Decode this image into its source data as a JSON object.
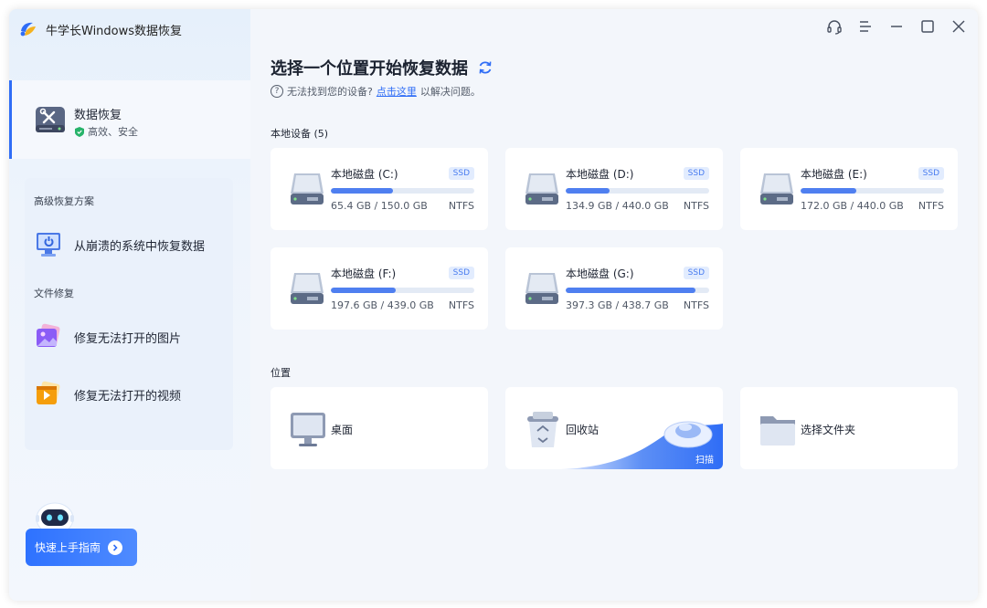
{
  "app": {
    "title": "牛学长Windows数据恢复"
  },
  "sidebar": {
    "active": {
      "label": "数据恢复",
      "sub": "高效、安全"
    },
    "advanced_label": "高级恢复方案",
    "crash_recovery": "从崩溃的系统中恢复数据",
    "file_repair_label": "文件修复",
    "repair_photo": "修复无法打开的图片",
    "repair_video": "修复无法打开的视频",
    "guide_button": "快速上手指南"
  },
  "main": {
    "title": "选择一个位置开始恢复数据",
    "help_prefix": "无法找到您的设备?",
    "help_link": "点击这里",
    "help_suffix": "以解决问题。",
    "local_label": "本地设备 (5)",
    "location_label": "位置"
  },
  "disks": [
    {
      "name": "本地磁盘 (C:)",
      "badge": "SSD",
      "used_gb": 65.4,
      "total_gb": 150.0,
      "size": "65.4 GB / 150.0 GB",
      "fs": "NTFS"
    },
    {
      "name": "本地磁盘 (D:)",
      "badge": "SSD",
      "used_gb": 134.9,
      "total_gb": 440.0,
      "size": "134.9 GB / 440.0 GB",
      "fs": "NTFS"
    },
    {
      "name": "本地磁盘 (E:)",
      "badge": "SSD",
      "used_gb": 172.0,
      "total_gb": 440.0,
      "size": "172.0 GB / 440.0 GB",
      "fs": "NTFS"
    },
    {
      "name": "本地磁盘 (F:)",
      "badge": "SSD",
      "used_gb": 197.6,
      "total_gb": 439.0,
      "size": "197.6 GB / 439.0 GB",
      "fs": "NTFS"
    },
    {
      "name": "本地磁盘 (G:)",
      "badge": "SSD",
      "used_gb": 397.3,
      "total_gb": 438.7,
      "size": "397.3 GB / 438.7 GB",
      "fs": "NTFS"
    }
  ],
  "locations": {
    "desktop": "桌面",
    "recycle": "回收站",
    "recycle_scan": "扫描",
    "folder": "选择文件夹"
  },
  "colors": {
    "accent": "#2f6df6",
    "progress": "#4f7ff0",
    "badge_bg": "#e2ecfe"
  },
  "icons": [
    "headset-icon",
    "menu-icon",
    "minimize-icon",
    "maximize-icon",
    "close-icon",
    "refresh-icon",
    "help-icon",
    "drive-icon",
    "monitor-icon",
    "trash-icon",
    "folder-icon",
    "shield-icon",
    "tools-icon",
    "robot-icon"
  ]
}
